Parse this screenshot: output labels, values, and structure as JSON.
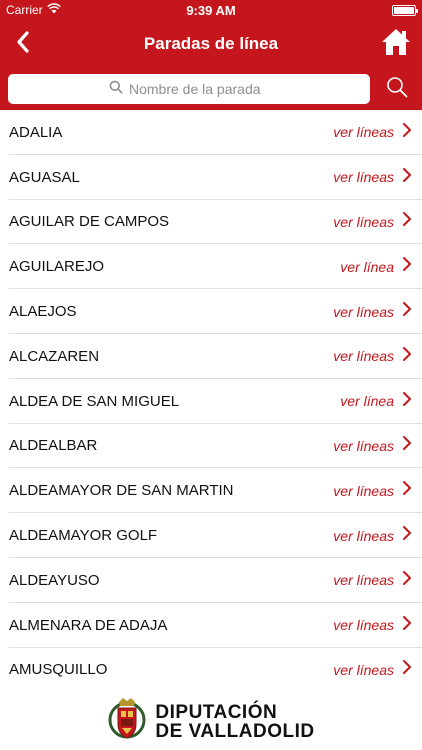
{
  "status_bar": {
    "carrier": "Carrier",
    "time": "9:39 AM",
    "battery_level": 1.0
  },
  "header": {
    "title": "Paradas de línea"
  },
  "search": {
    "placeholder": "Nombre de la parada",
    "value": ""
  },
  "stops": [
    {
      "name": "ADALIA",
      "link": "ver líneas"
    },
    {
      "name": "AGUASAL",
      "link": "ver líneas"
    },
    {
      "name": "AGUILAR DE CAMPOS",
      "link": "ver líneas"
    },
    {
      "name": "AGUILAREJO",
      "link": "ver línea"
    },
    {
      "name": "ALAEJOS",
      "link": "ver líneas"
    },
    {
      "name": "ALCAZAREN",
      "link": "ver líneas"
    },
    {
      "name": "ALDEA DE SAN MIGUEL",
      "link": "ver línea"
    },
    {
      "name": "ALDEALBAR",
      "link": "ver líneas"
    },
    {
      "name": "ALDEAMAYOR DE SAN MARTIN",
      "link": "ver líneas"
    },
    {
      "name": "ALDEAMAYOR GOLF",
      "link": "ver líneas"
    },
    {
      "name": "ALDEAYUSO",
      "link": "ver líneas"
    },
    {
      "name": "ALMENARA DE ADAJA",
      "link": "ver líneas"
    },
    {
      "name": "AMUSQUILLO",
      "link": "ver líneas"
    }
  ],
  "footer": {
    "line1": "DIPUTACIÓN",
    "line2": "DE VALLADOLID"
  },
  "icons": {
    "back": "chevron-left-icon",
    "home": "home-icon",
    "search": "search-icon",
    "row": "chevron-right-icon"
  },
  "colors": {
    "brand": "#c4161c",
    "text": "#111111",
    "link": "#c4161c",
    "separator": "#e0e0e0"
  }
}
